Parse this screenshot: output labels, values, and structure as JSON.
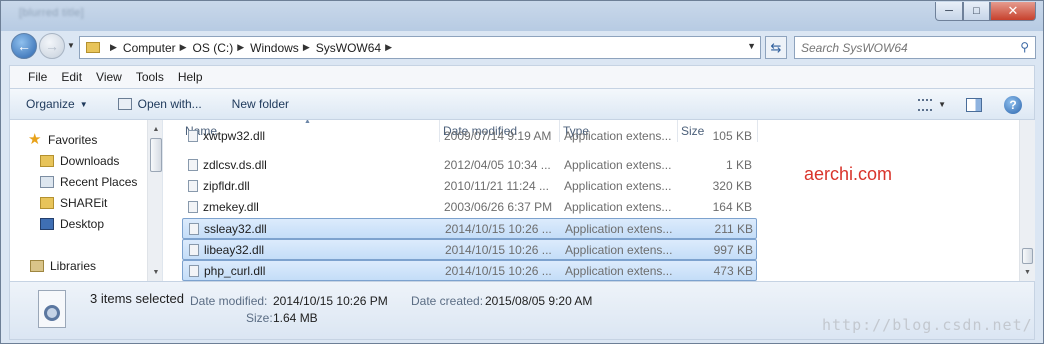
{
  "window": {
    "title": "[blurred title]",
    "controls": {
      "minimize": "─",
      "maximize": "□",
      "close": "✕"
    }
  },
  "address": {
    "crumbs": [
      "Computer",
      "OS (C:)",
      "Windows",
      "SysWOW64"
    ],
    "search_placeholder": "Search SysWOW64"
  },
  "menu": [
    "File",
    "Edit",
    "View",
    "Tools",
    "Help"
  ],
  "commands": {
    "organize": "Organize",
    "open_with": "Open with...",
    "new_folder": "New folder"
  },
  "nav": {
    "favorites": "Favorites",
    "downloads": "Downloads",
    "recent": "Recent Places",
    "shareit": "SHAREit",
    "desktop": "Desktop",
    "libraries": "Libraries"
  },
  "columns": {
    "name": "Name",
    "date": "Date modified",
    "type": "Type",
    "size": "Size"
  },
  "files": [
    {
      "name": "xwtpw32.dll",
      "date": "2009/07/14 9:19 AM",
      "type": "Application extens...",
      "size": "105 KB",
      "selected": false
    },
    {
      "name": "zdlcsv.ds.dll",
      "date": "2012/04/05 10:34 ...",
      "type": "Application extens...",
      "size": "1 KB",
      "selected": false
    },
    {
      "name": "zipfldr.dll",
      "date": "2010/11/21 11:24 ...",
      "type": "Application extens...",
      "size": "320 KB",
      "selected": false
    },
    {
      "name": "zmekey.dll",
      "date": "2003/06/26 6:37 PM",
      "type": "Application extens...",
      "size": "164 KB",
      "selected": false
    },
    {
      "name": "ssleay32.dll",
      "date": "2014/10/15 10:26 ...",
      "type": "Application extens...",
      "size": "211 KB",
      "selected": true
    },
    {
      "name": "libeay32.dll",
      "date": "2014/10/15 10:26 ...",
      "type": "Application extens...",
      "size": "997 KB",
      "selected": true
    },
    {
      "name": "php_curl.dll",
      "date": "2014/10/15 10:26 ...",
      "type": "Application extens...",
      "size": "473 KB",
      "selected": true
    }
  ],
  "overlay_text": "aerchi.com",
  "details": {
    "selection": "3 items selected",
    "date_modified_label": "Date modified:",
    "date_modified": "2014/10/15 10:26 PM",
    "date_created_label": "Date created:",
    "date_created": "2015/08/05 9:20 AM",
    "size_label": "Size:",
    "size": "1.64 MB"
  },
  "watermark": "http://blog.csdn.net/"
}
